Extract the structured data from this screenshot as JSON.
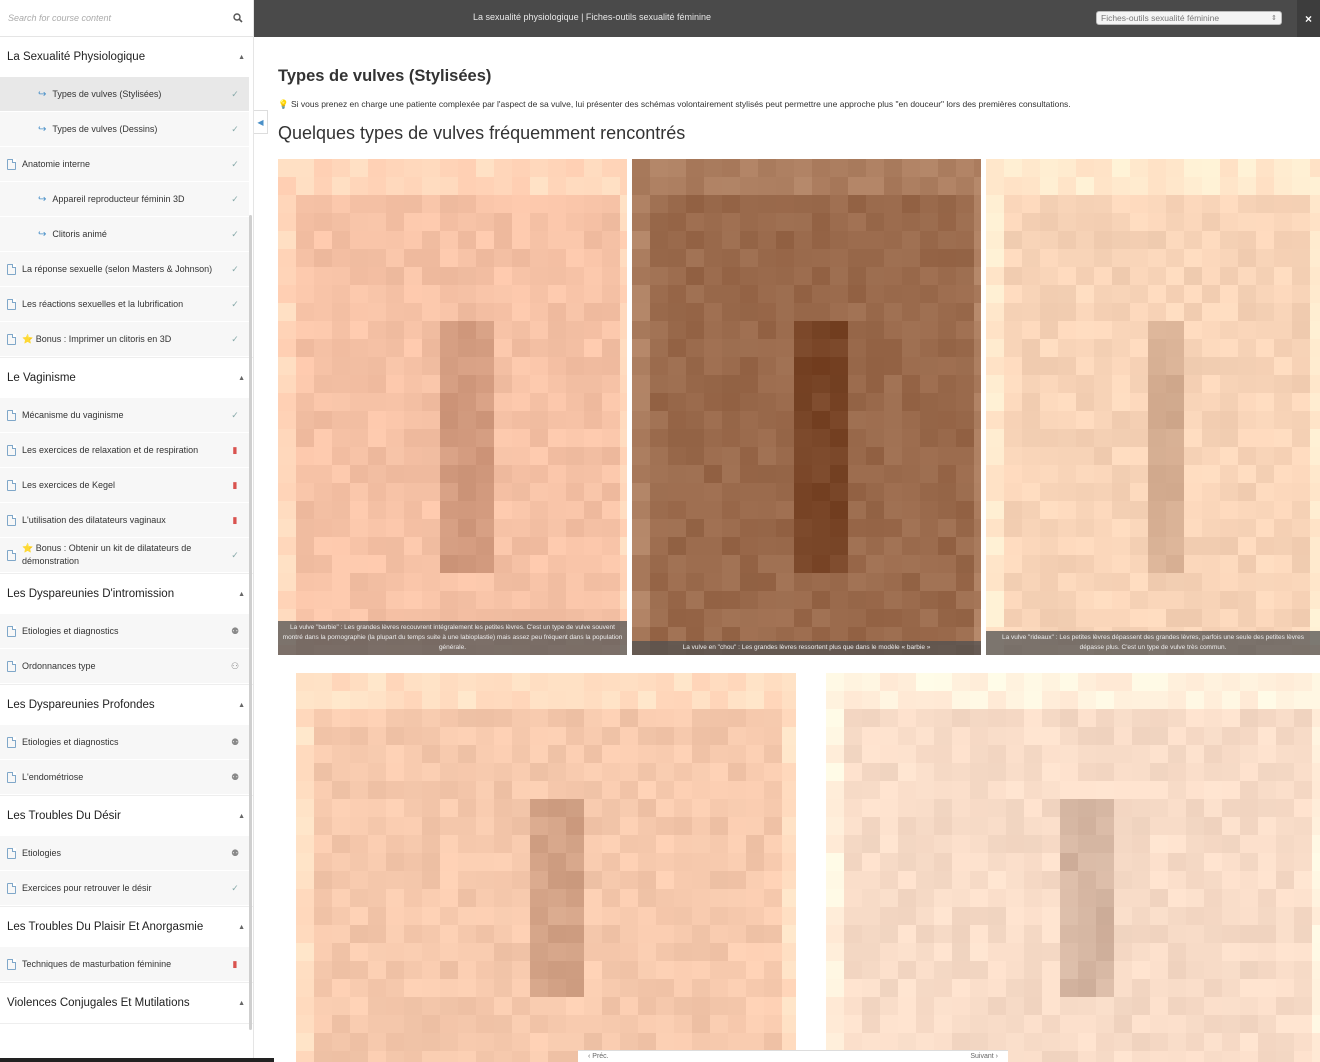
{
  "search": {
    "placeholder": "Search for course content"
  },
  "topbar": {
    "title": "La sexualité physiologique | Fiches-outils sexualité féminine",
    "select_value": "Fiches-outils sexualité féminine",
    "close_label": "×"
  },
  "sidebar": {
    "sections": [
      {
        "title": "La Sexualité Physiologique",
        "lessons": [
          {
            "label": "Types de vulves (Stylisées)",
            "sub": true,
            "active": true,
            "status": "check"
          },
          {
            "label": "Types de vulves (Dessins)",
            "sub": true,
            "status": "check"
          },
          {
            "label": "Anatomie interne",
            "status": "check"
          },
          {
            "label": "Appareil reproducteur féminin 3D",
            "sub": true,
            "status": "check"
          },
          {
            "label": "Clitoris animé",
            "sub": true,
            "status": "check"
          },
          {
            "label": "La réponse sexuelle (selon Masters & Johnson)",
            "status": "check"
          },
          {
            "label": "Les réactions sexuelles et la lubrification",
            "status": "check"
          },
          {
            "label": "⭐ Bonus : Imprimer un clitoris en 3D",
            "status": "check"
          }
        ]
      },
      {
        "title": "Le Vaginisme",
        "lessons": [
          {
            "label": "Mécanisme du vaginisme",
            "status": "check"
          },
          {
            "label": "Les exercices de relaxation et de respiration",
            "status": "pdf"
          },
          {
            "label": "Les exercices de Kegel",
            "status": "pdf"
          },
          {
            "label": "L'utilisation des dilatateurs vaginaux",
            "status": "pdf"
          },
          {
            "label": "⭐ Bonus : Obtenir un kit de dilatateurs de démonstration",
            "status": "check"
          }
        ]
      },
      {
        "title": "Les Dyspareunies D'intromission",
        "lessons": [
          {
            "label": "Etiologies et diagnostics",
            "status": "user"
          },
          {
            "label": "Ordonnances type",
            "status": "users"
          }
        ]
      },
      {
        "title": "Les Dyspareunies Profondes",
        "lessons": [
          {
            "label": "Etiologies et diagnostics",
            "status": "user"
          },
          {
            "label": "L'endométriose",
            "status": "user"
          }
        ]
      },
      {
        "title": "Les Troubles Du Désir",
        "lessons": [
          {
            "label": "Etiologies",
            "status": "user"
          },
          {
            "label": "Exercices pour retrouver le désir",
            "status": "check"
          }
        ]
      },
      {
        "title": "Les Troubles Du Plaisir Et Anorgasmie",
        "lessons": [
          {
            "label": "Techniques de masturbation féminine",
            "status": "pdf"
          }
        ]
      },
      {
        "title": "Violences Conjugales Et Mutilations",
        "lessons": []
      }
    ]
  },
  "content": {
    "title": "Types de vulves (Stylisées)",
    "tip": "Si vous prenez en charge une patiente complexée par l'aspect de sa vulve, lui présenter des schémas volontairement stylisés peut permettre une approche plus \"en douceur\" lors des premières consultations.",
    "subtitle": "Quelques types de vulves fréquemment rencontrés",
    "figures": [
      {
        "caption": "La vulve \"barbie\" : Les grandes lèvres recouvrent intégralement les petites lèvres. C'est un type de vulve souvent montré dans la pornographie (la plupart du temps suite à une labioplastie) mais assez peu fréquent dans la population générale.",
        "color": "#f6c2a6"
      },
      {
        "caption": "La vulve en \"chou\" : Les grandes lèvres ressortent plus que dans le modèle « barbie »",
        "color": "#9a6a4c"
      },
      {
        "caption": "La vulve \"rideaux\" : Les petites lèvres dépassent des grandes lèvres, parfois une seule des petites lèvres dépasse plus. C'est un type de vulve très commun.",
        "color": "#f8d4b8"
      },
      {
        "caption": "",
        "color": "#f6c9ad"
      },
      {
        "caption": "",
        "color": "#f8dcc8"
      }
    ]
  },
  "bottom_nav": {
    "prev": "‹ Préc.",
    "next": "Suivant ›"
  }
}
